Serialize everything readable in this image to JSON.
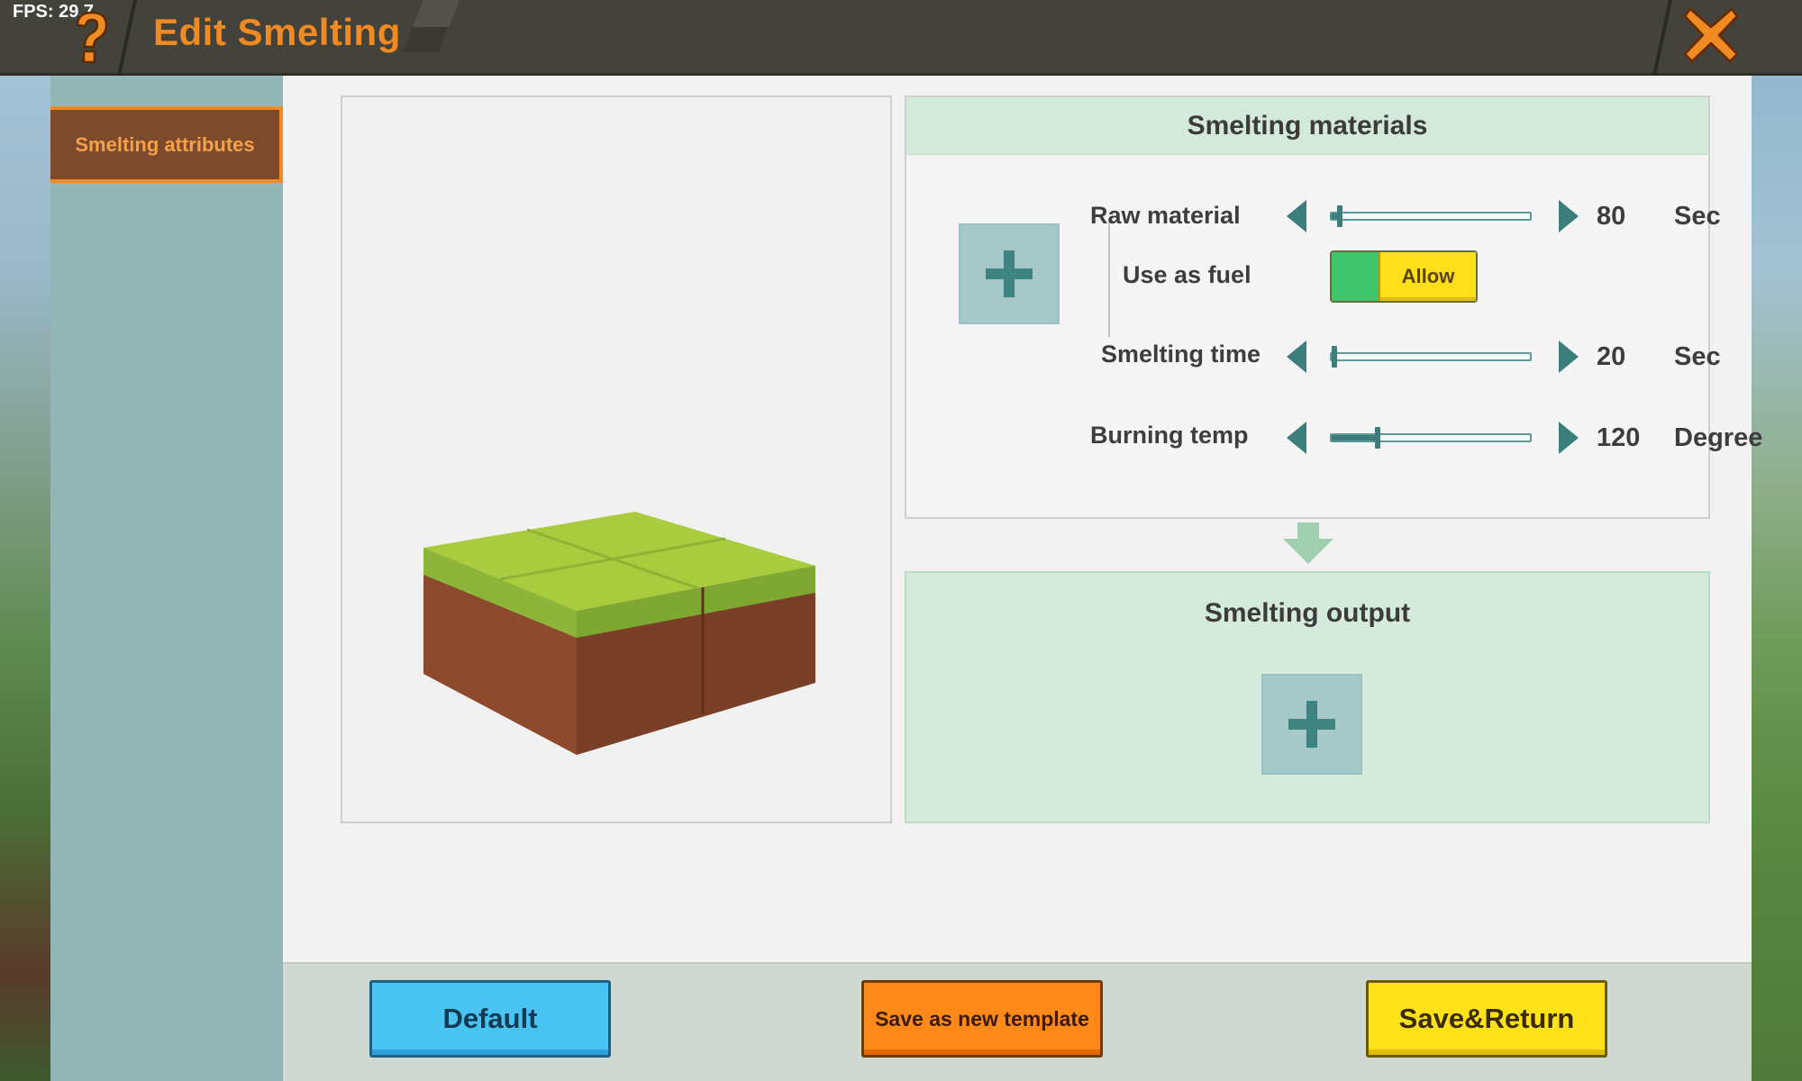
{
  "topbar": {
    "fps": "FPS: 29.7",
    "title": "Edit Smelting",
    "help_icon": "question-mark-icon",
    "close_icon": "close-x-icon"
  },
  "sidebar": {
    "tabs": [
      {
        "label": "Smelting attributes",
        "selected": true
      }
    ]
  },
  "preview": {
    "icon": "grass-block-icon"
  },
  "materials": {
    "header": "Smelting materials",
    "raw_material": {
      "label": "Raw material",
      "value": "80",
      "unit": "Sec",
      "fraction": 0.04
    },
    "use_as_fuel": {
      "label": "Use as fuel",
      "toggle_label": "Allow",
      "on": true
    },
    "smelting_time": {
      "label": "Smelting time",
      "value": "20",
      "unit": "Sec",
      "fraction": 0.01
    },
    "burning_temp": {
      "label": "Burning temp",
      "value": "120",
      "unit": "Degree",
      "fraction": 0.23
    }
  },
  "output": {
    "header": "Smelting output"
  },
  "buttons": {
    "default": "Default",
    "save_template": "Save as new template",
    "save_return": "Save&Return"
  },
  "colors": {
    "title": "#f08a22",
    "accent_teal": "#3b7e7b",
    "toggle_on": "#3ec46a",
    "toggle_knob": "#ffdf1a"
  }
}
